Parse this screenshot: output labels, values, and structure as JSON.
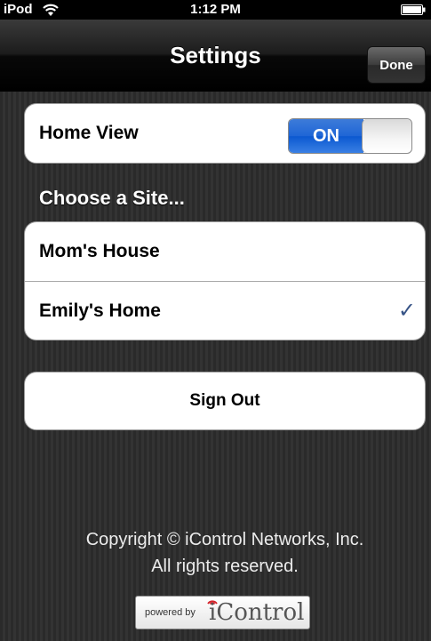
{
  "status_bar": {
    "carrier": "iPod",
    "time": "1:12 PM",
    "wifi_icon": "wifi-icon",
    "battery_icon": "battery-full-icon"
  },
  "nav_bar": {
    "title": "Settings",
    "done_label": "Done"
  },
  "home_view": {
    "label": "Home View",
    "toggle_text": "ON",
    "toggle_state": true,
    "accent_color": "#1f66d6"
  },
  "sites": {
    "header": "Choose a Site...",
    "items": [
      {
        "label": "Mom's House",
        "selected": false
      },
      {
        "label": "Emily's Home",
        "selected": true,
        "check": "✓"
      }
    ]
  },
  "sign_out": {
    "label": "Sign Out"
  },
  "footer": {
    "copyright_line1": "Copyright © iControl Networks, Inc.",
    "copyright_line2": "All rights reserved.",
    "powered_by": "powered by",
    "brand": "iControl"
  }
}
